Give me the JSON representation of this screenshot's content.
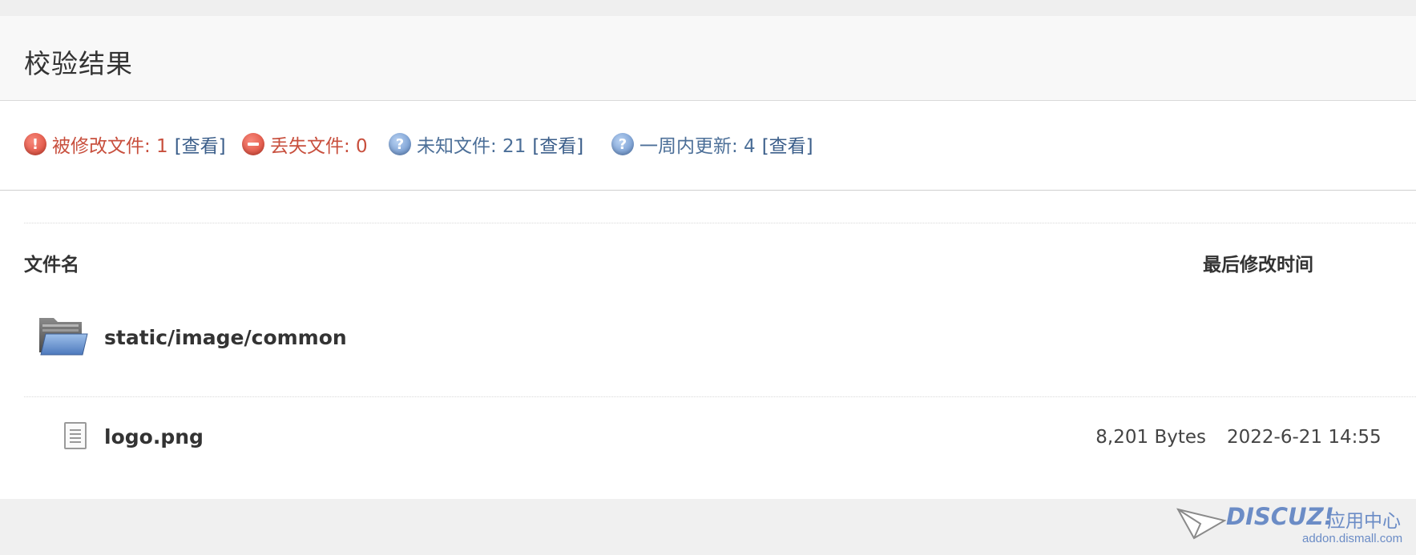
{
  "panel": {
    "title": "校验结果"
  },
  "summary": {
    "modified": {
      "label": "被修改文件: 1",
      "link": "[查看]"
    },
    "missing": {
      "label": "丢失文件: 0"
    },
    "unknown": {
      "label": "未知文件: 21",
      "link": "[查看]"
    },
    "week": {
      "label": "一周内更新: 4",
      "link": "[查看]"
    }
  },
  "table": {
    "headers": {
      "filename": "文件名",
      "modified_time": "最后修改时间"
    },
    "directory": {
      "name": "static/image/common",
      "icon": "folder-icon"
    },
    "files": [
      {
        "name": "logo.png",
        "size": "8,201 Bytes",
        "time": "2022-6-21 14:55",
        "icon": "file-icon"
      }
    ]
  },
  "footer_logo": {
    "brand": "DISCUZ!",
    "cn": "应用中心",
    "url": "addon.dismall.com"
  },
  "colors": {
    "modified": "#c84f3d",
    "unknown": "#4c6f98",
    "link": "#3b5e8a"
  }
}
